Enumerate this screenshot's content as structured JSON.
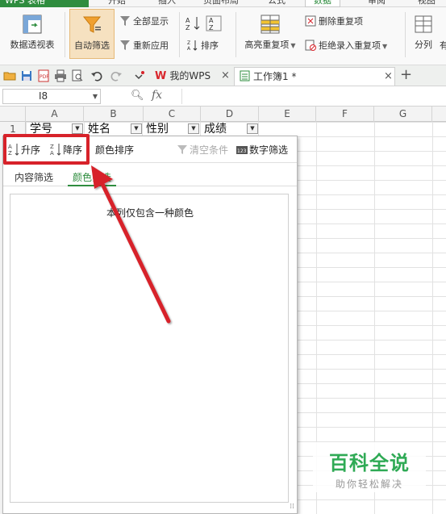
{
  "app": {
    "title": "WPS 表格"
  },
  "menu_tabs": [
    "开始",
    "插入",
    "页面布局",
    "公式",
    "数据",
    "审阅",
    "视图"
  ],
  "active_menu_tab": "数据",
  "ribbon": {
    "pivot_table": "数据透视表",
    "auto_filter": "自动筛选",
    "show_all": "全部显示",
    "reapply": "重新应用",
    "sort": "排序",
    "highlight_duplicates": "高亮重复项",
    "remove_duplicates": "删除重复项",
    "reject_duplicate_entry": "拒绝录入重复项",
    "split_column": "分列",
    "more": "有"
  },
  "tabs": {
    "my_wps": "我的WPS",
    "workbook": "工作簿1 *",
    "add": "+",
    "close": "×"
  },
  "formula_bar": {
    "cell_ref": "I8",
    "fx_label": "fx",
    "formula": ""
  },
  "sheet": {
    "columns": [
      "A",
      "B",
      "C",
      "D",
      "E",
      "F",
      "G"
    ],
    "row_numbers": [
      "1"
    ],
    "headers": [
      "学号",
      "姓名",
      "性别",
      "成绩"
    ]
  },
  "filter_popup": {
    "ascending": "升序",
    "descending": "降序",
    "color_sort": "颜色排序",
    "clear_condition": "清空条件",
    "number_filter": "数字筛选",
    "tabs": [
      "内容筛选",
      "颜色筛选"
    ],
    "active_tab": "颜色筛选",
    "message": "本列仅包含一种颜色"
  },
  "watermark": {
    "title": "百科全说",
    "subtitle": "助你轻松解决"
  },
  "colors": {
    "accent_green": "#2f8d3f",
    "annotation_red": "#d7222a",
    "watermark_green": "#2faa55"
  }
}
